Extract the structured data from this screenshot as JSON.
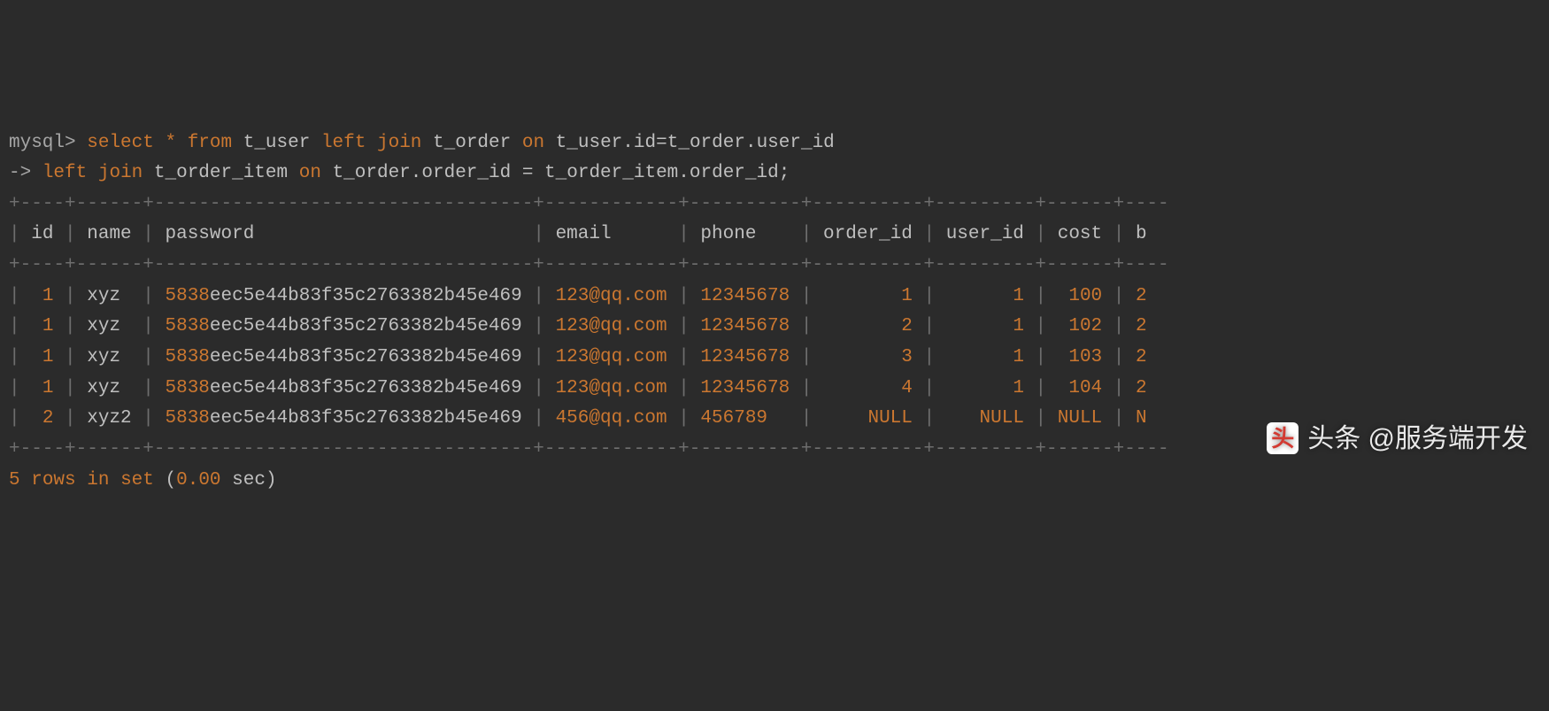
{
  "prompt1": "mysql>",
  "prompt2": "->",
  "query_parts": {
    "select": "select",
    "star": "*",
    "from": "from",
    "t_user": "t_user",
    "left": "left",
    "join": "join",
    "t_order": "t_order",
    "on": "on",
    "t_user_id": "t_user",
    "dot1": ".",
    "idcol": "id",
    "eq": "=",
    "t_order2": "t_order",
    "dot2": ".",
    "user_id": "user_id",
    "t_order_item": "t_order_item",
    "t_order3": "t_order",
    "dot3": ".",
    "order_id": "order_id",
    "eq2": "=",
    "t_order_item2": "t_order_item",
    "dot4": ".",
    "order_id2": "order_id",
    "semi": ";"
  },
  "headers": [
    "id",
    "name",
    "password",
    "email",
    "phone",
    "order_id",
    "user_id",
    "cost",
    "b"
  ],
  "border_row": "+----+------+----------------------------------+------------+----------+----------+---------+------+--",
  "rows": [
    {
      "id": "1",
      "name": "xyz",
      "pw_pre": "5838",
      "pw_rest": "eec5e44b83f35c2763382b45e469",
      "email": "123@qq.com",
      "phone": "12345678",
      "order_id": "1",
      "user_id": "1",
      "cost": "100",
      "b": "2"
    },
    {
      "id": "1",
      "name": "xyz",
      "pw_pre": "5838",
      "pw_rest": "eec5e44b83f35c2763382b45e469",
      "email": "123@qq.com",
      "phone": "12345678",
      "order_id": "2",
      "user_id": "1",
      "cost": "102",
      "b": "2"
    },
    {
      "id": "1",
      "name": "xyz",
      "pw_pre": "5838",
      "pw_rest": "eec5e44b83f35c2763382b45e469",
      "email": "123@qq.com",
      "phone": "12345678",
      "order_id": "3",
      "user_id": "1",
      "cost": "103",
      "b": "2"
    },
    {
      "id": "1",
      "name": "xyz",
      "pw_pre": "5838",
      "pw_rest": "eec5e44b83f35c2763382b45e469",
      "email": "123@qq.com",
      "phone": "12345678",
      "order_id": "4",
      "user_id": "1",
      "cost": "104",
      "b": "2"
    },
    {
      "id": "2",
      "name": "xyz2",
      "pw_pre": "5838",
      "pw_rest": "eec5e44b83f35c2763382b45e469",
      "email": "456@qq.com",
      "phone": "456789",
      "order_id": "NULL",
      "user_id": "NULL",
      "cost": "NULL",
      "b": "N"
    }
  ],
  "summary": {
    "count": "5",
    "rows_word": "rows",
    "in_word": "in",
    "set_word": "set",
    "open": "(",
    "time": "0.00",
    "sec": " sec)"
  },
  "watermark": {
    "icon": "头",
    "text": "头条 @服务端开发"
  }
}
